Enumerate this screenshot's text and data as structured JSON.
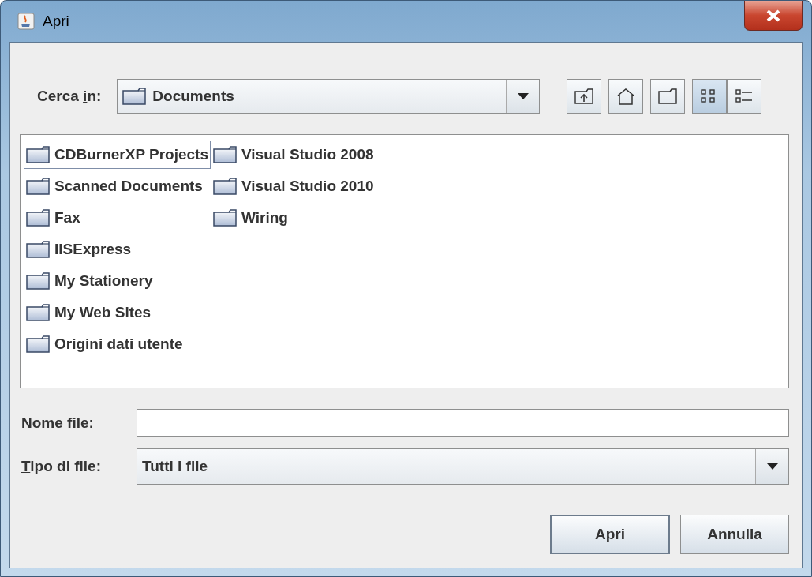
{
  "window": {
    "title": "Apri"
  },
  "look_in": {
    "label": {
      "before": "Cerca ",
      "mnemonic": "i",
      "after": "n:"
    },
    "value": "Documents"
  },
  "toolbar": [
    {
      "kind": "up",
      "selected": false
    },
    {
      "kind": "home",
      "selected": false
    },
    {
      "kind": "new-folder",
      "selected": false
    },
    {
      "kind": "list-view",
      "selected": true
    },
    {
      "kind": "details-view",
      "selected": false
    }
  ],
  "files": [
    {
      "name": "CDBurnerXP Projects",
      "focused": true
    },
    {
      "name": "Scanned Documents",
      "focused": false
    },
    {
      "name": "Fax",
      "focused": false
    },
    {
      "name": "IISExpress",
      "focused": false
    },
    {
      "name": "My Stationery",
      "focused": false
    },
    {
      "name": "My Web Sites",
      "focused": false
    },
    {
      "name": "Origini dati utente",
      "focused": false
    },
    {
      "name": "Visual Studio 2008",
      "focused": false
    },
    {
      "name": "Visual Studio 2010",
      "focused": false
    },
    {
      "name": "Wiring",
      "focused": false
    }
  ],
  "file_name": {
    "label": {
      "mnemonic": "N",
      "after": "ome file:"
    }
  },
  "file_type": {
    "label": {
      "mnemonic": "T",
      "after": "ipo di file:"
    },
    "value": "Tutti i file"
  },
  "buttons": [
    {
      "label": "Apri",
      "default": true
    },
    {
      "label": "Annulla",
      "default": false
    }
  ]
}
